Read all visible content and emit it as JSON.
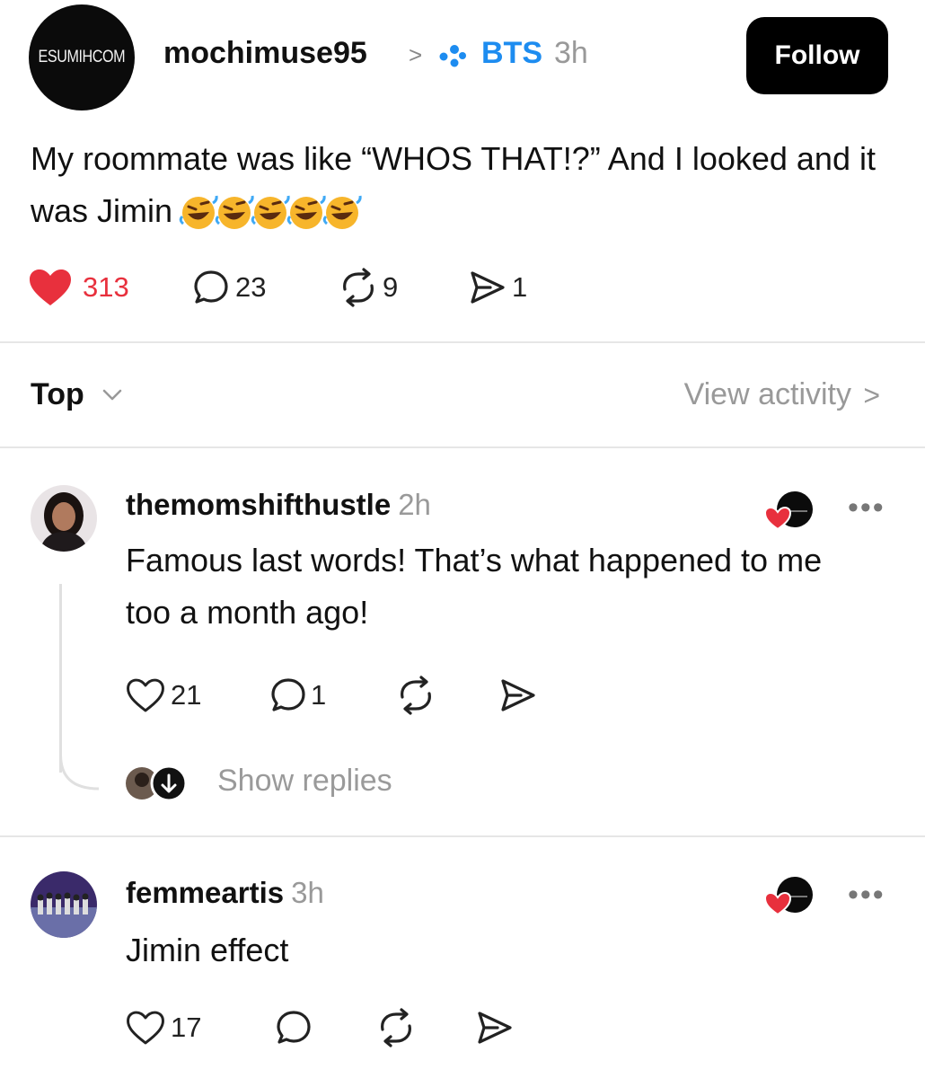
{
  "post": {
    "author_avatar_text": "ESUMIHCOM",
    "author": "mochimuse95",
    "separator": ">",
    "community": "BTS",
    "time": "3h",
    "follow_label": "Follow",
    "text": "My roommate was like “WHOS THAT!?” And I looked and it was Jimin",
    "emoji": [
      "rolling-on-floor-laughing",
      "rolling-on-floor-laughing",
      "rolling-on-floor-laughing",
      "rolling-on-floor-laughing",
      "rolling-on-floor-laughing"
    ],
    "likes": "313",
    "comments": "23",
    "reposts": "9",
    "shares": "1",
    "liked": true
  },
  "sort": {
    "label": "Top",
    "view_activity": "View activity",
    "view_chevron": ">"
  },
  "comments": [
    {
      "user": "themomshifthustle",
      "time": "2h",
      "text": "Famous last words! That’s what happened to me too a month ago!",
      "likes": "21",
      "replies": "1",
      "more": "•••",
      "show_replies": "Show replies"
    },
    {
      "user": "femmeartis",
      "time": "3h",
      "text": "Jimin effect",
      "likes": "17",
      "more": "•••"
    }
  ],
  "colors": {
    "like_red": "#e8303d",
    "community_blue": "#1d8cf0",
    "muted_gray": "#999999",
    "divider": "#e6e6e6"
  },
  "icons": [
    "heart-icon",
    "comment-icon",
    "repost-icon",
    "share-icon",
    "chevron-down-icon",
    "more-icon",
    "community-icon"
  ]
}
